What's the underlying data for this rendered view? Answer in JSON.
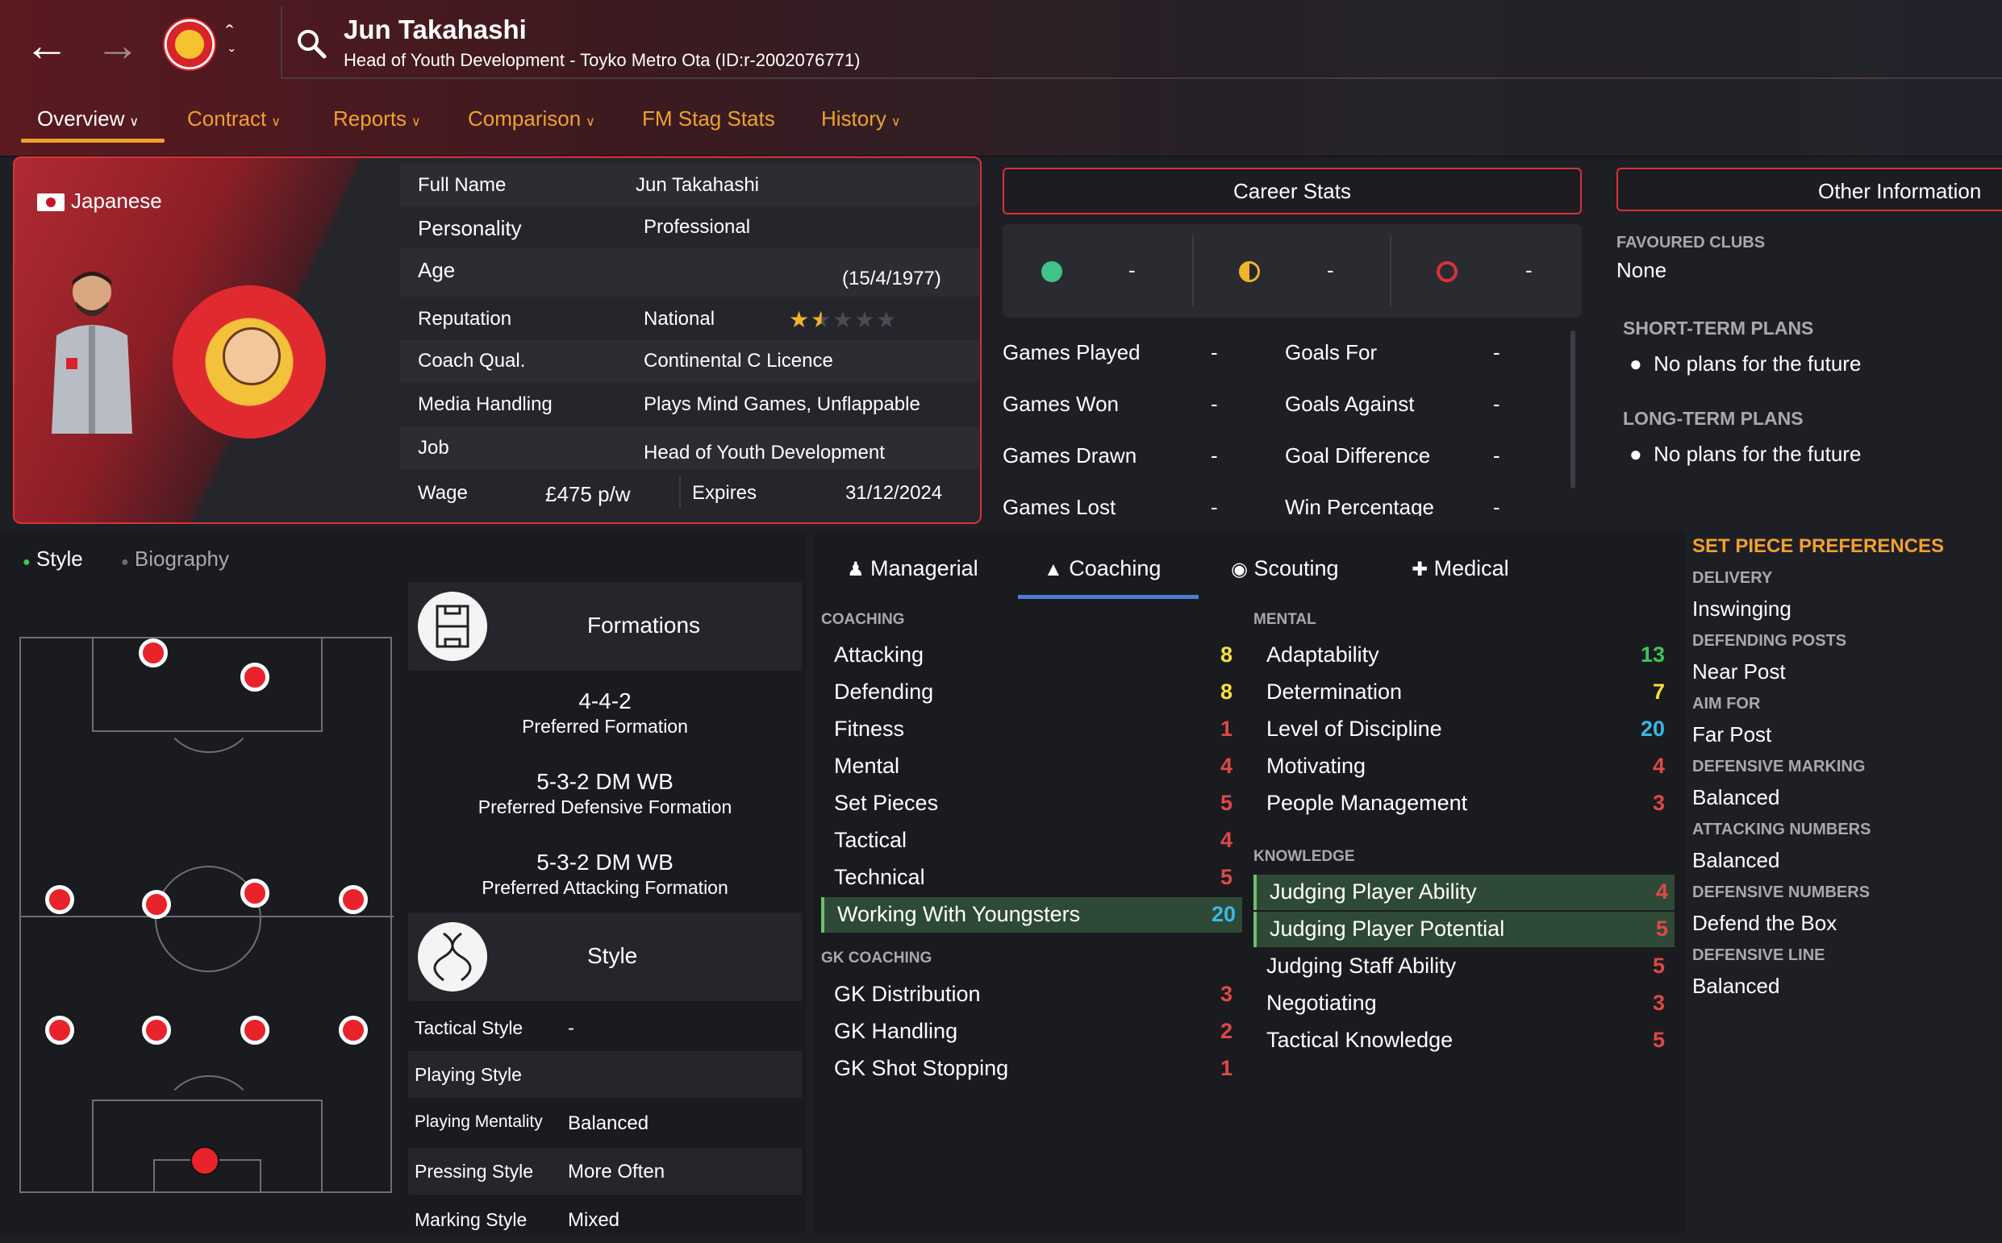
{
  "header": {
    "name": "Jun Takahashi",
    "subtitle": "Head of Youth Development - Toyko Metro Ota (ID:r-2002076771)"
  },
  "tabs": [
    {
      "label": "Overview"
    },
    {
      "label": "Contract"
    },
    {
      "label": "Reports"
    },
    {
      "label": "Comparison"
    },
    {
      "label": "FM Stag Stats"
    },
    {
      "label": "History"
    }
  ],
  "profile": {
    "nationality": "Japanese",
    "rows": {
      "full_name": {
        "label": "Full Name",
        "value": "Jun Takahashi"
      },
      "personality": {
        "label": "Personality",
        "value": "Professional"
      },
      "age": {
        "label": "Age",
        "value": "(15/4/1977)"
      },
      "reputation": {
        "label": "Reputation",
        "value": "National",
        "stars": 1.5,
        "stars_max": 5
      },
      "coach_qual": {
        "label": "Coach Qual.",
        "value": "Continental C Licence"
      },
      "media": {
        "label": "Media Handling",
        "value": "Plays Mind Games, Unflappable"
      },
      "job": {
        "label": "Job",
        "value": "Head of Youth Development"
      },
      "wage": {
        "label": "Wage",
        "value": "£475 p/w",
        "expires_label": "Expires",
        "expires": "31/12/2024"
      }
    }
  },
  "career_stats": {
    "title": "Career Stats",
    "summary": [
      "-",
      "-",
      "-"
    ],
    "colors": {
      "win": "#3ec48a",
      "draw": "#f0b429",
      "loss": "#d8323a"
    },
    "rows": [
      {
        "label": "Games Played",
        "value": "-",
        "label2": "Goals For",
        "value2": "-"
      },
      {
        "label": "Games Won",
        "value": "-",
        "label2": "Goals Against",
        "value2": "-"
      },
      {
        "label": "Games Drawn",
        "value": "-",
        "label2": "Goal Difference",
        "value2": "-"
      },
      {
        "label": "Games Lost",
        "value": "-",
        "label2": "Win Percentage",
        "value2": "-"
      }
    ]
  },
  "other_info": {
    "title": "Other Information",
    "favoured_label": "FAVOURED CLUBS",
    "favoured": "None",
    "short_label": "SHORT-TERM PLANS",
    "short": "No plans for the future",
    "long_label": "LONG-TERM PLANS",
    "long": "No plans for the future"
  },
  "subtabs": {
    "style": "Style",
    "biography": "Biography"
  },
  "formations": {
    "title": "Formations",
    "preferred": "4-4-2",
    "preferred_label": "Preferred Formation",
    "defensive": "5-3-2 DM WB",
    "defensive_label": "Preferred Defensive Formation",
    "attacking": "5-3-2 DM WB",
    "attacking_label": "Preferred Attacking Formation"
  },
  "style": {
    "title": "Style",
    "rows": [
      {
        "label": "Tactical Style",
        "value": "-"
      },
      {
        "label": "Playing Style",
        "value": ""
      },
      {
        "label": "Playing Mentality",
        "value": "Balanced"
      },
      {
        "label": "Pressing Style",
        "value": "More Often"
      },
      {
        "label": "Marking Style",
        "value": "Mixed"
      }
    ]
  },
  "attr_tabs": {
    "managerial": "Managerial",
    "coaching": "Coaching",
    "scouting": "Scouting",
    "medical": "Medical"
  },
  "coaching": {
    "head": "COACHING",
    "items": [
      {
        "name": "Attacking",
        "value": "8"
      },
      {
        "name": "Defending",
        "value": "8"
      },
      {
        "name": "Fitness",
        "value": "1"
      },
      {
        "name": "Mental",
        "value": "4"
      },
      {
        "name": "Set Pieces",
        "value": "5"
      },
      {
        "name": "Tactical",
        "value": "4"
      },
      {
        "name": "Technical",
        "value": "5"
      },
      {
        "name": "Working With Youngsters",
        "value": "20"
      }
    ]
  },
  "gk_coaching": {
    "head": "GK COACHING",
    "items": [
      {
        "name": "GK Distribution",
        "value": "3"
      },
      {
        "name": "GK Handling",
        "value": "2"
      },
      {
        "name": "GK Shot Stopping",
        "value": "1"
      }
    ]
  },
  "mental": {
    "head": "MENTAL",
    "items": [
      {
        "name": "Adaptability",
        "value": "13"
      },
      {
        "name": "Determination",
        "value": "7"
      },
      {
        "name": "Level of Discipline",
        "value": "20"
      },
      {
        "name": "Motivating",
        "value": "4"
      },
      {
        "name": "People Management",
        "value": "3"
      }
    ]
  },
  "knowledge": {
    "head": "KNOWLEDGE",
    "items": [
      {
        "name": "Judging Player Ability",
        "value": "4"
      },
      {
        "name": "Judging Player Potential",
        "value": "5"
      },
      {
        "name": "Judging Staff Ability",
        "value": "5"
      },
      {
        "name": "Negotiating",
        "value": "3"
      },
      {
        "name": "Tactical Knowledge",
        "value": "5"
      }
    ]
  },
  "set_pieces": {
    "title": "SET PIECE PREFERENCES",
    "items": [
      {
        "label": "DELIVERY",
        "value": "Inswinging"
      },
      {
        "label": "DEFENDING POSTS",
        "value": "Near Post"
      },
      {
        "label": "AIM FOR",
        "value": "Far Post"
      },
      {
        "label": "DEFENSIVE MARKING",
        "value": "Balanced"
      },
      {
        "label": "ATTACKING NUMBERS",
        "value": "Balanced"
      },
      {
        "label": "DEFENSIVE NUMBERS",
        "value": "Defend the Box"
      },
      {
        "label": "DEFENSIVE LINE",
        "value": "Balanced"
      }
    ]
  },
  "value_colors": {
    "low": "#e04848",
    "mid": "#f0c030",
    "good": "#f7e23a",
    "high": "#3ec45a",
    "top": "#3ab8e8"
  }
}
